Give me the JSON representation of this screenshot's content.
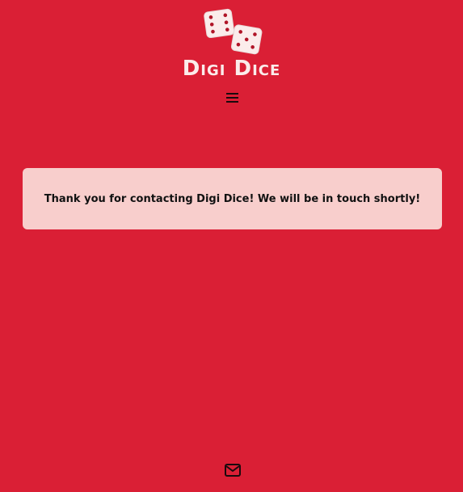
{
  "header": {
    "brand_name": "Digi Dice",
    "logo_icon": "dice-icon",
    "menu_icon": "hamburger-menu-icon"
  },
  "main": {
    "confirmation_message": "Thank you for contacting Digi Dice! We will be in touch shortly!"
  },
  "footer": {
    "contact_icon": "envelope-icon"
  },
  "colors": {
    "background": "#da1f35",
    "message_background": "#f8cecc",
    "brand_text": "#fbeceb"
  }
}
